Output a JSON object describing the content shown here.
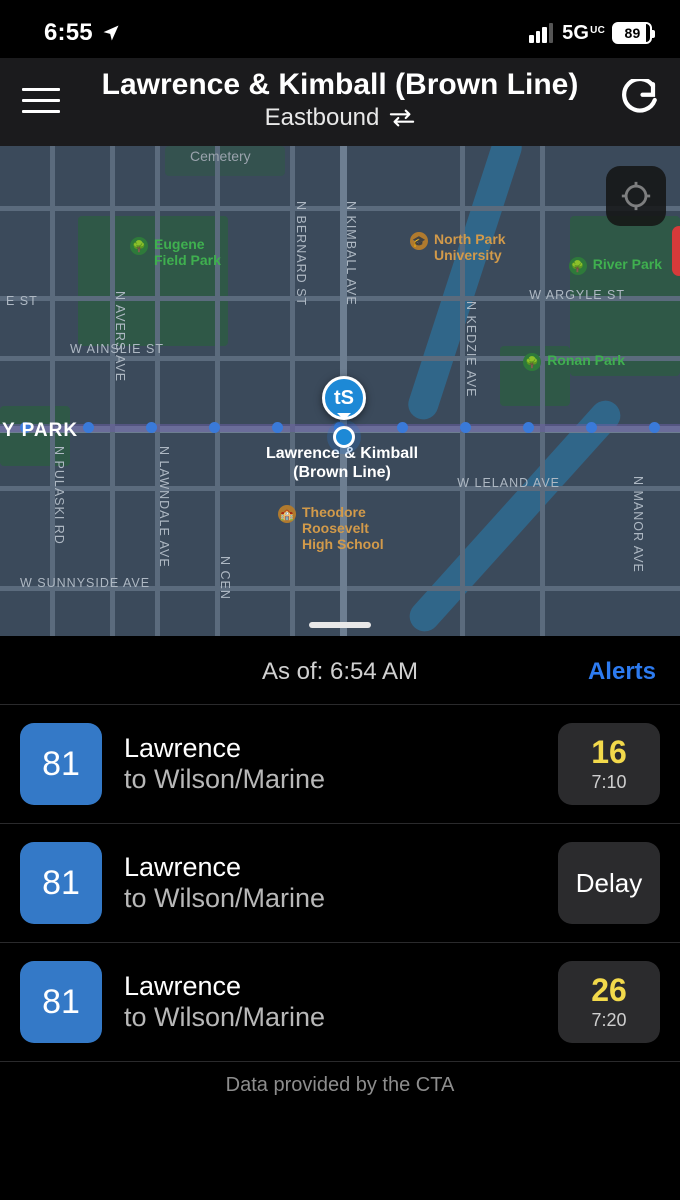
{
  "status_bar": {
    "time": "6:55",
    "network": "5G",
    "network_sub": "UC",
    "battery": "89"
  },
  "header": {
    "title": "Lawrence & Kimball (Brown Line)",
    "direction": "Eastbound"
  },
  "map": {
    "stop_name": "Lawrence & Kimball",
    "stop_sub": "(Brown Line)",
    "big_park": "Y PARK",
    "streets": {
      "ainslie": "W AINSLIE ST",
      "argyle": "W ARGYLE ST",
      "leland": "W LELAND AVE",
      "sunnyside": "W SUNNYSIDE AVE",
      "e_st": "E ST",
      "kimball": "N KIMBALL AVE",
      "kedzie": "N KEDZIE AVE",
      "bernard": "N BERNARD ST",
      "avers": "N AVERS AVE",
      "manor": "N MANOR AVE",
      "lawndale": "N LAWNDALE AVE",
      "central": "N CEN",
      "pulaski": "N PULASKI RD"
    },
    "pois": {
      "eugene": "Eugene\nField Park",
      "northpark": "North Park\nUniversity",
      "riverpark": "River Park",
      "ronan": "Ronan Park",
      "roosevelt": "Theodore\nRoosevelt\nHigh School",
      "cemetery": "Cemetery"
    }
  },
  "arrivals": {
    "asof_label": "As of: 6:54 AM",
    "alerts_label": "Alerts",
    "rows": [
      {
        "route": "81",
        "name": "Lawrence",
        "dest": "to Wilson/Marine",
        "eta": "16",
        "eta_type": "min",
        "time": "7:10"
      },
      {
        "route": "81",
        "name": "Lawrence",
        "dest": "to Wilson/Marine",
        "eta": "Delay",
        "eta_type": "delay",
        "time": ""
      },
      {
        "route": "81",
        "name": "Lawrence",
        "dest": "to Wilson/Marine",
        "eta": "26",
        "eta_type": "min",
        "time": "7:20"
      }
    ]
  },
  "footer": "Data provided by the CTA"
}
